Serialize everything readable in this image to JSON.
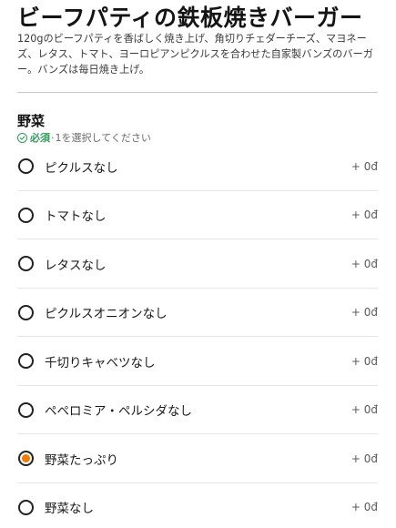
{
  "product": {
    "title": "ビーフパティの鉄板焼きバーガー",
    "description": "120gのビーフパティを香ばしく焼き上げ、角切りチェダーチーズ、マヨネーズ、レタス、トマト、ヨーロピアンピクルスを合わせた自家製バンズのバーガー。バンズは毎日焼き上げ。"
  },
  "section": {
    "title": "野菜",
    "required_label": "必須",
    "separator": "·",
    "instruction": "1を選択してください"
  },
  "options": [
    {
      "label": "ピクルスなし",
      "price": "+ 0đ",
      "selected": false
    },
    {
      "label": "トマトなし",
      "price": "+ 0đ",
      "selected": false
    },
    {
      "label": "レタスなし",
      "price": "+ 0đ",
      "selected": false
    },
    {
      "label": "ピクルスオニオンなし",
      "price": "+ 0đ",
      "selected": false
    },
    {
      "label": "千切りキャベツなし",
      "price": "+ 0đ",
      "selected": false
    },
    {
      "label": "ペペロミア・ペルシダなし",
      "price": "+ 0đ",
      "selected": false
    },
    {
      "label": "野菜たっぷり",
      "price": "+ 0đ",
      "selected": true
    },
    {
      "label": "野菜なし",
      "price": "+ 0đ",
      "selected": false
    }
  ],
  "colors": {
    "accent": "#f57c00",
    "required": "#2e9e5b"
  }
}
